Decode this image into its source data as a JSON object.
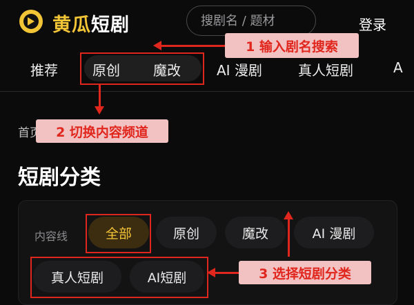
{
  "header": {
    "logo_yellow": "黄瓜",
    "logo_white": "短剧",
    "search_placeholder": "搜剧名 / 题材",
    "login": "登录"
  },
  "nav": {
    "tabs": [
      "推荐",
      "原创",
      "魔改",
      "AI 漫剧",
      "真人短剧",
      "A"
    ]
  },
  "breadcrumb": "首页",
  "section_title": "短剧分类",
  "filter": {
    "label": "内容线",
    "chips": [
      "全部",
      "原创",
      "魔改",
      "AI 漫剧",
      "真人短剧",
      "AI短剧"
    ],
    "active": "全部"
  },
  "annotations": {
    "a1": "1 输入剧名搜索",
    "a2": "2 切换内容频道",
    "a3": "3 选择短剧分类"
  },
  "colors": {
    "brand": "#f2c537",
    "annotation": "#e0261d"
  }
}
